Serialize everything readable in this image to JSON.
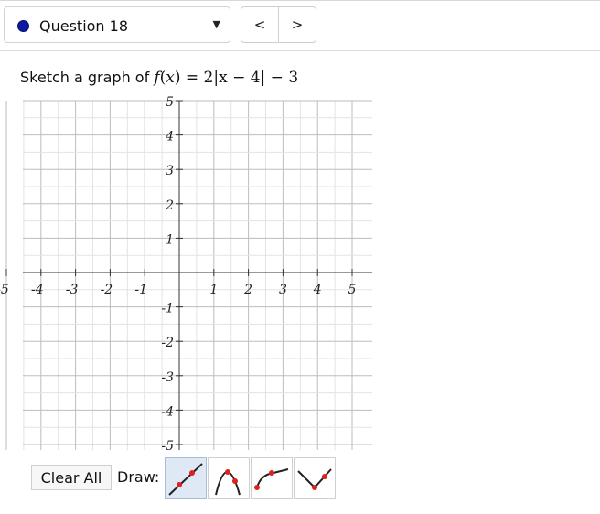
{
  "question_selector": {
    "label": "Question 18",
    "status_color": "#0b1a9e"
  },
  "nav": {
    "prev_label": "<",
    "next_label": ">"
  },
  "prompt": {
    "text": "Sketch a graph of",
    "function_lhs": "f",
    "function_var": "x",
    "function_rhs": "= 2|x − 4| − 3"
  },
  "graph": {
    "x_ticks": [
      "-5",
      "-4",
      "-3",
      "-2",
      "-1",
      "1",
      "2",
      "3",
      "4",
      "5"
    ],
    "y_ticks": [
      "5",
      "4",
      "3",
      "2",
      "1",
      "-1",
      "-2",
      "-3",
      "-4",
      "-5"
    ],
    "xmin": -5,
    "xmax": 5,
    "ymin": -5,
    "ymax": 5,
    "grid": true
  },
  "controls": {
    "clear_all_label": "Clear All",
    "draw_label": "Draw:",
    "tools": [
      {
        "name": "line-tool-icon",
        "selected": true
      },
      {
        "name": "parabola-tool-icon",
        "selected": false
      },
      {
        "name": "sqrt-curve-tool-icon",
        "selected": false
      },
      {
        "name": "absolute-value-tool-icon",
        "selected": false
      }
    ]
  }
}
